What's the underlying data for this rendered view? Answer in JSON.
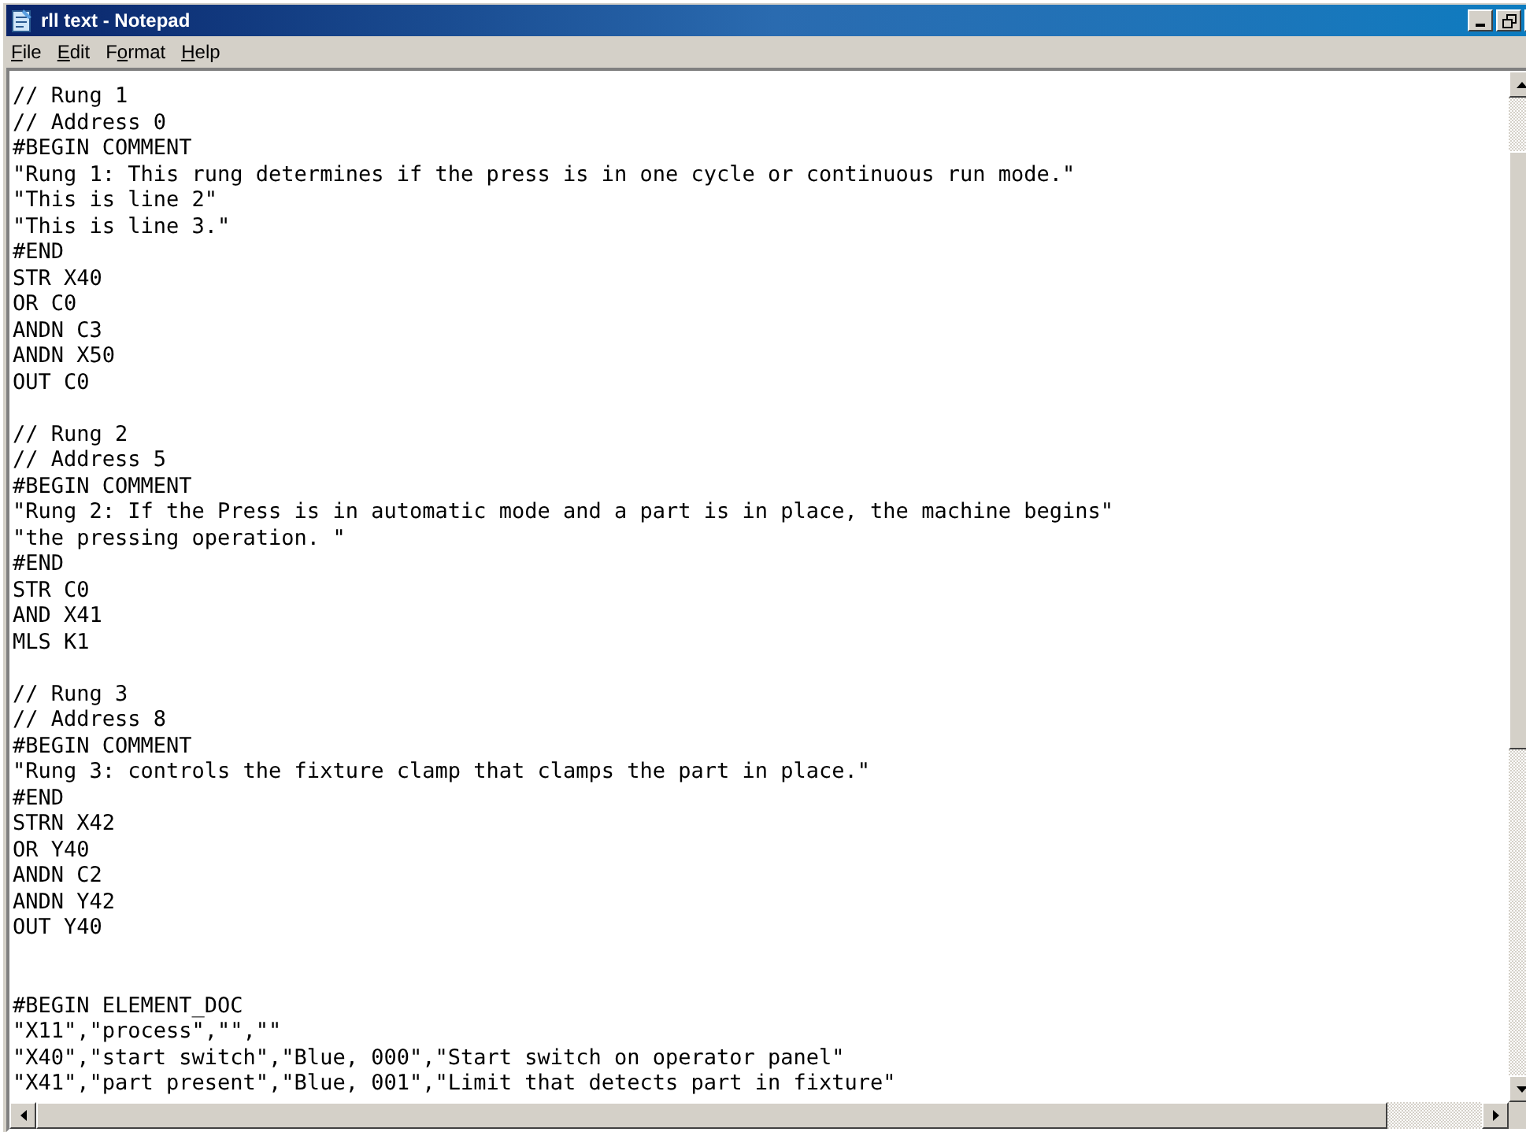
{
  "window": {
    "title": "rll text - Notepad"
  },
  "menu": [
    {
      "parts": [
        {
          "text": "F",
          "underlined": true
        },
        {
          "text": "ile",
          "underlined": false
        }
      ]
    },
    {
      "parts": [
        {
          "text": "E",
          "underlined": true
        },
        {
          "text": "dit",
          "underlined": false
        }
      ]
    },
    {
      "parts": [
        {
          "text": "F",
          "underlined": false
        },
        {
          "text": "o",
          "underlined": true
        },
        {
          "text": "rmat",
          "underlined": false
        }
      ]
    },
    {
      "parts": [
        {
          "text": "H",
          "underlined": true
        },
        {
          "text": "elp",
          "underlined": false
        }
      ]
    }
  ],
  "document": {
    "rungs": [
      [
        "// Rung 1",
        "// Address 0",
        "#BEGIN COMMENT",
        "\"Rung 1: This rung determines if the press is in one cycle or continuous run mode.\"",
        "\"This is line 2\"",
        "\"This is line 3.\"",
        "#END",
        "STR X40",
        "OR C0",
        "ANDN C3",
        "ANDN X50",
        "OUT C0"
      ],
      [
        "// Rung 2",
        "// Address 5",
        "#BEGIN COMMENT",
        "\"Rung 2: If the Press is in automatic mode and a part is in place, the machine begins\"",
        "\"the pressing operation. \"",
        "#END",
        "STR C0",
        "AND X41",
        "MLS K1"
      ],
      [
        "// Rung 3",
        "// Address 8",
        "#BEGIN COMMENT",
        "\"Rung 3: controls the fixture clamp that clamps the part in place.\"",
        "#END",
        "STRN X42",
        "OR Y40",
        "ANDN C2",
        "ANDN Y42",
        "OUT Y40"
      ]
    ],
    "element_doc": [
      "#BEGIN ELEMENT_DOC",
      "\"X11\",\"process\",\"\",\"\"",
      "\"X40\",\"start switch\",\"Blue, 000\",\"Start switch on operator panel\"",
      "\"X41\",\"part present\",\"Blue, 001\",\"Limit that detects part in fixture\""
    ]
  }
}
